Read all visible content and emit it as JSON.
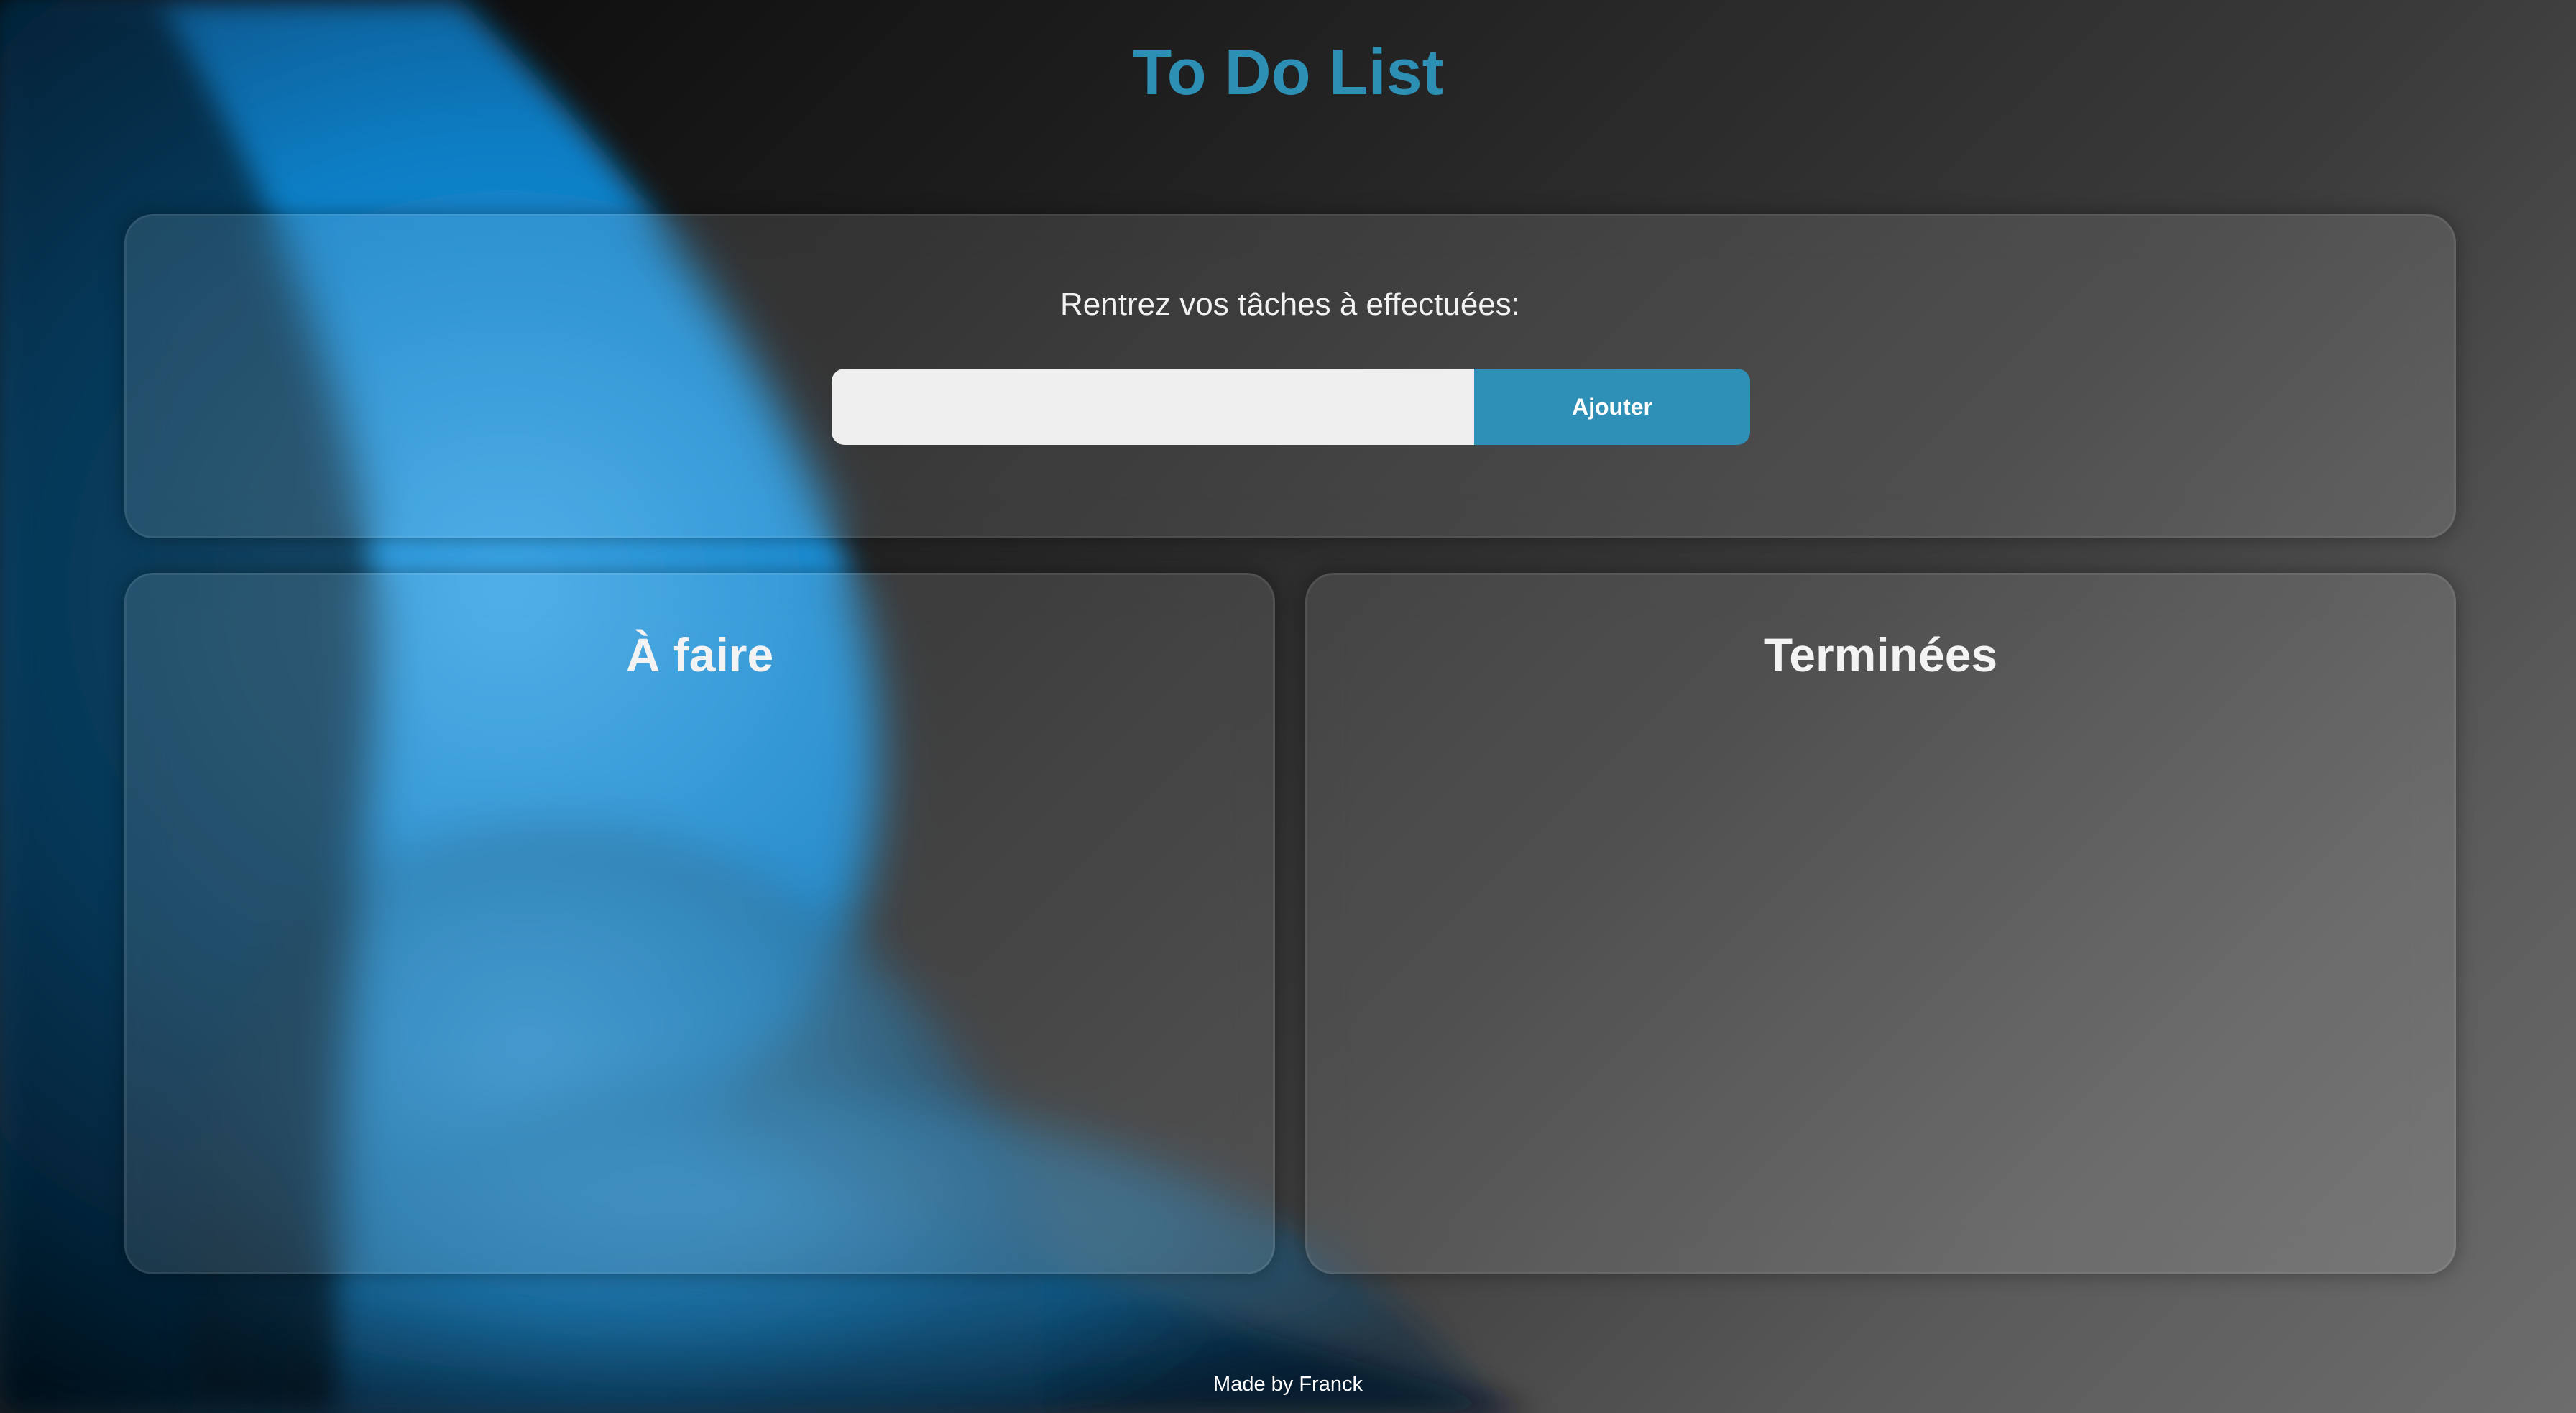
{
  "header": {
    "title": "To Do List"
  },
  "input_section": {
    "prompt": "Rentrez vos tâches à effectuées:",
    "input_value": "",
    "placeholder": "",
    "add_button_label": "Ajouter"
  },
  "columns": {
    "todo": {
      "title": "À faire",
      "items": []
    },
    "done": {
      "title": "Terminées",
      "items": []
    }
  },
  "footer": {
    "text": "Made by Franck"
  },
  "colors": {
    "accent": "#2e8fb4",
    "button": "#2e90b6",
    "input_background": "#efefef",
    "background_blue": "#0b7fc5"
  }
}
